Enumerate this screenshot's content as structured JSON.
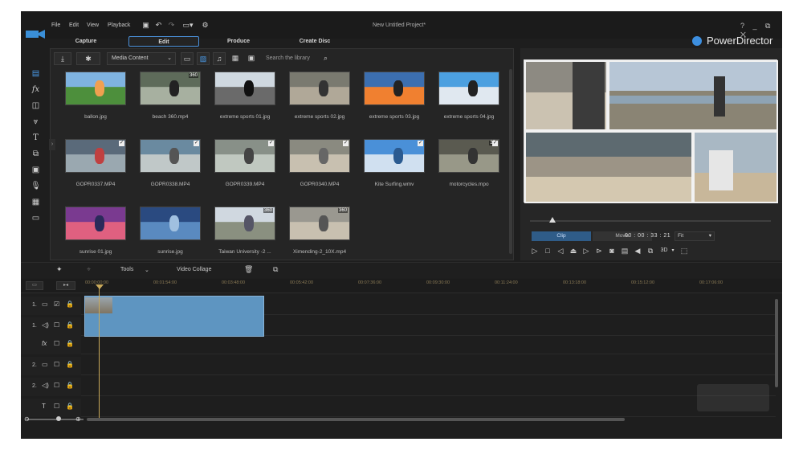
{
  "menu": {
    "file": "File",
    "edit": "Edit",
    "view": "View",
    "playback": "Playback"
  },
  "window_title": "New Untitled Project*",
  "window_controls": "? _ ⧉ ✕",
  "tabs": {
    "capture": "Capture",
    "edit": "Edit",
    "produce": "Produce",
    "create_disc": "Create Disc"
  },
  "brand": "PowerDirector",
  "media": {
    "content_select": "Media Content",
    "search_placeholder": "Search the library",
    "items": [
      {
        "label": "ballon.jpg",
        "badge": ""
      },
      {
        "label": "beach 360.mp4",
        "badge": "360"
      },
      {
        "label": "extreme sports 01.jpg",
        "badge": ""
      },
      {
        "label": "extreme sports 02.jpg",
        "badge": ""
      },
      {
        "label": "extreme sports 03.jpg",
        "badge": ""
      },
      {
        "label": "extreme sports 04.jpg",
        "badge": ""
      },
      {
        "label": "GOPR0337.MP4",
        "badge": ""
      },
      {
        "label": "GOPR0338.MP4",
        "badge": ""
      },
      {
        "label": "GOPR0339.MP4",
        "badge": ""
      },
      {
        "label": "GOPR0340.MP4",
        "badge": ""
      },
      {
        "label": "Kite Surfing.wmv",
        "badge": ""
      },
      {
        "label": "motorcycles.mpo",
        "badge": "3D"
      },
      {
        "label": "sunrise 01.jpg",
        "badge": ""
      },
      {
        "label": "sunrise.jpg",
        "badge": ""
      },
      {
        "label": "Taiwan University -2 ...",
        "badge": "360"
      },
      {
        "label": "Ximending-2_10X.mp4",
        "badge": "360"
      }
    ]
  },
  "preview": {
    "clip_label": "Clip",
    "movie_label": "Movie",
    "timecode": "00 : 00 : 33 : 21",
    "fit_label": "Fit",
    "threed_label": "3D"
  },
  "edit_toolbar": {
    "tools": "Tools",
    "video_collage": "Video Collage"
  },
  "ruler": {
    "ticks": [
      "00:00:00:00",
      "00:01:54:00",
      "00:03:48:00",
      "00:05:42:00",
      "00:07:36:00",
      "00:09:30:00",
      "00:11:24:00",
      "00:13:18:00",
      "00:15:12:00",
      "00:17:06:00"
    ]
  },
  "tracks": [
    {
      "num": "1."
    },
    {
      "num": "1."
    },
    {
      "num": ""
    },
    {
      "num": "2."
    },
    {
      "num": "2."
    },
    {
      "num": ""
    }
  ],
  "colors": {
    "accent": "#3d8fe0",
    "clip": "#5e95c1",
    "playhead": "#c9a95a"
  }
}
